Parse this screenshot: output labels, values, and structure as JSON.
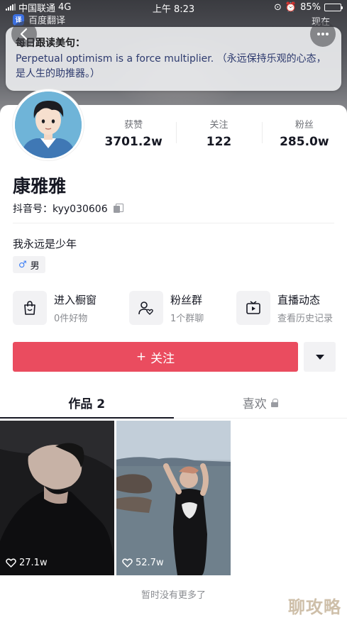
{
  "status_bar": {
    "carrier": "中国联通",
    "network": "4G",
    "time": "上午 8:23",
    "battery": "85%",
    "battery_level": 0.85
  },
  "overlay": {
    "app_name": "百度翻译",
    "now_label": "现在",
    "card_title": "每日跟读美句：",
    "card_text": "Perpetual optimism is a force multiplier. （永远保持乐观的心态，是人生的助推器。）"
  },
  "profile": {
    "stats": [
      {
        "label": "获赞",
        "value": "3701.2w"
      },
      {
        "label": "关注",
        "value": "122"
      },
      {
        "label": "粉丝",
        "value": "285.0w"
      }
    ],
    "nickname": "康雅雅",
    "douyin_id": "抖音号：kyy030606",
    "bio": "我永远是少年",
    "gender_symbol": "♂",
    "gender": "男"
  },
  "entries": [
    {
      "title": "进入橱窗",
      "subtitle": "0件好物",
      "icon": "shopping-bag-icon"
    },
    {
      "title": "粉丝群",
      "subtitle": "1个群聊",
      "icon": "group-heart-icon"
    },
    {
      "title": "直播动态",
      "subtitle": "查看历史记录",
      "icon": "tv-play-icon"
    }
  ],
  "actions": {
    "follow_label": "关注",
    "follow_plus": "+",
    "accent_color": "#ea4c5f"
  },
  "tabs": [
    {
      "label": "作品 2",
      "active": true
    },
    {
      "label": "喜欢",
      "active": false,
      "locked": true
    }
  ],
  "videos": [
    {
      "likes": "27.1w"
    },
    {
      "likes": "52.7w"
    }
  ],
  "footer": {
    "no_more": "暂时没有更多了",
    "watermark": "聊攻略"
  }
}
